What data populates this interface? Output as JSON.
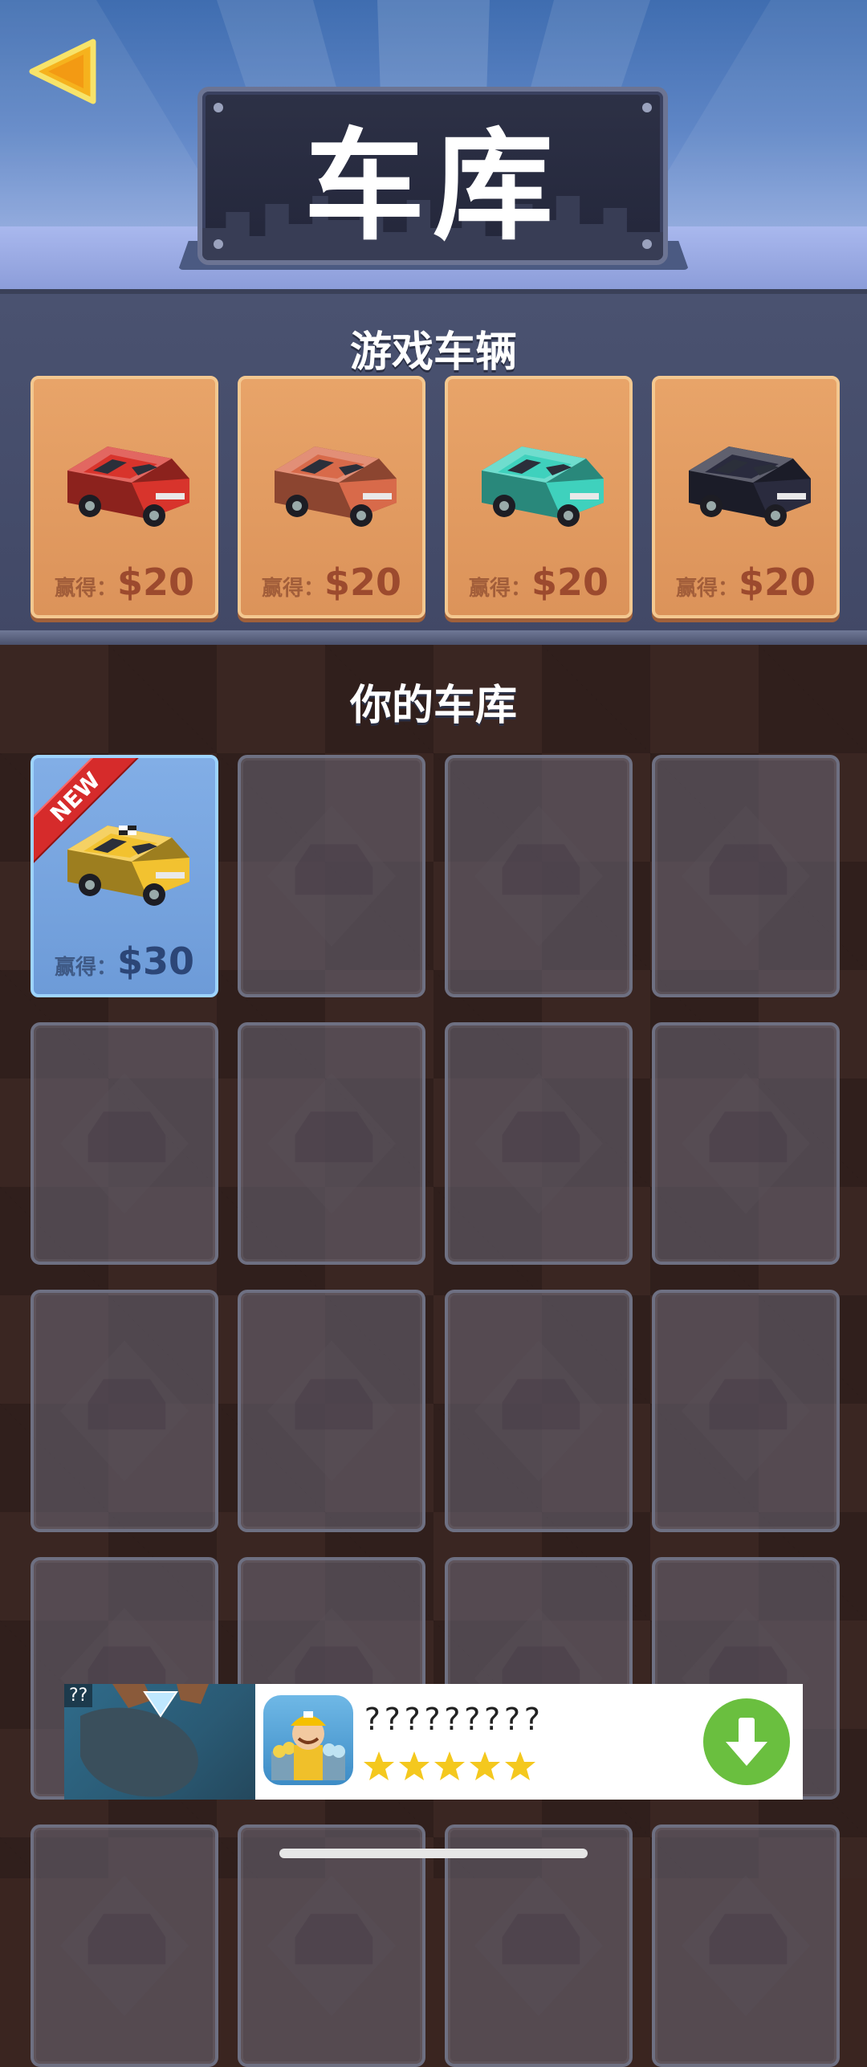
{
  "header": {
    "title": "车库"
  },
  "shop": {
    "title": "游戏车辆",
    "cards": [
      {
        "car": "red-car",
        "price_label": "赢得：",
        "price": "$20",
        "color": "#d8342c"
      },
      {
        "car": "orange-car",
        "price_label": "赢得：",
        "price": "$20",
        "color": "#d86a4a"
      },
      {
        "car": "teal-car",
        "price_label": "赢得：",
        "price": "$20",
        "color": "#3fd1bd"
      },
      {
        "car": "black-car",
        "price_label": "赢得：",
        "price": "$20",
        "color": "#2a2b3e"
      }
    ]
  },
  "garage": {
    "title": "你的车库",
    "owned": [
      {
        "car": "taxi",
        "ribbon": "NEW",
        "price_label": "赢得：",
        "price": "$30",
        "color": "#f2c230"
      }
    ],
    "empty_slot_icon": "garage-silhouette-icon"
  },
  "ad": {
    "badge": "??",
    "title": "?????????",
    "rating": 5,
    "download_icon": "download-arrow-icon"
  }
}
